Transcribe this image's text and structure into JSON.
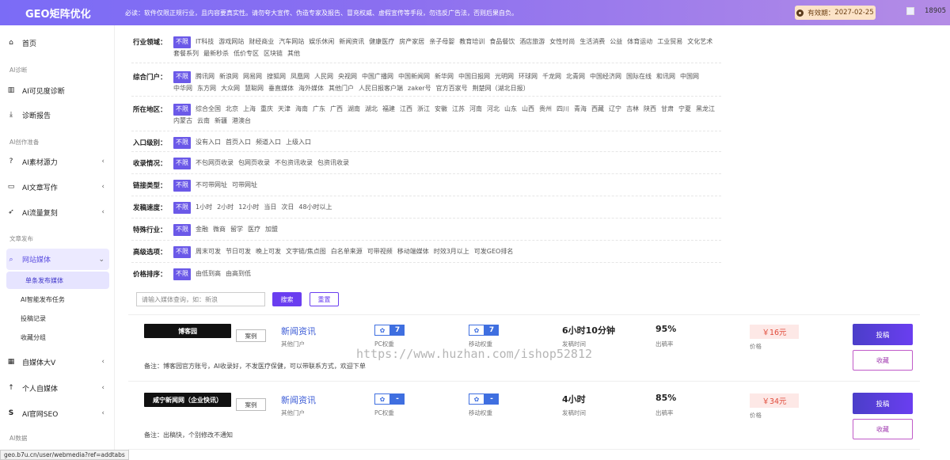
{
  "topbar": {
    "brand": "GEO矩阵优化",
    "notice": "必读：软件仅限正规行业，且内容要真实性。请勿夸大宣传、伪造专家及报告、冒充权威、虚假宣传等手段，勿违反广告法，否则后果自负。",
    "expire_label": "有效期：",
    "expire_date": "2027-02-25",
    "user_id": "18905"
  },
  "sidebar": {
    "home": "首页",
    "sec_ai_diag": "AI诊断",
    "ai_visible": "AI可见度诊断",
    "diag_report": "诊断报告",
    "sec_ai_create": "AI创作准备",
    "ai_source": "AI素材源力",
    "ai_article": "AI文章写作",
    "ai_traffic": "AI流量复刻",
    "sec_publish": "文章发布",
    "web_media": "网站媒体",
    "single_publish": "单条发布媒体",
    "ai_smart_task": "AI智能发布任务",
    "post_record": "投稿记录",
    "fav_group": "收藏分组",
    "self_media_v": "自媒体大V",
    "personal_media": "个人自媒体",
    "ai_official_seo": "AI官网SEO",
    "sec_ai_data": "AI数据"
  },
  "filters": [
    {
      "label": "行业领域：",
      "options": [
        "不限",
        "IT科技",
        "游戏网站",
        "财经商业",
        "汽车网站",
        "娱乐休闲",
        "新闻资讯",
        "健康医疗",
        "房产家居",
        "亲子母婴",
        "教育培训",
        "食品餐饮",
        "酒店旅游",
        "女性时尚",
        "生活消费",
        "公益",
        "体育运动",
        "工业贸易",
        "文化艺术",
        "套餐系列",
        "最新秒杀",
        "低价专区",
        "区块链",
        "其他"
      ]
    },
    {
      "label": "综合门户：",
      "options": [
        "不限",
        "腾讯网",
        "新浪网",
        "网易网",
        "搜狐网",
        "凤凰网",
        "人民网",
        "央视网",
        "中国广播网",
        "中国新闻网",
        "新华网",
        "中国日报网",
        "光明网",
        "环球网",
        "千龙网",
        "北青网",
        "中国经济网",
        "国际在线",
        "和讯网",
        "中国网",
        "中华网",
        "东方网",
        "大众网",
        "慧聪网",
        "垂直媒体",
        "海外媒体",
        "其他门户",
        "人民日报客户端",
        "zaker号",
        "官方百家号",
        "荆楚网（湖北日报）"
      ]
    },
    {
      "label": "所在地区：",
      "options": [
        "不限",
        "综合全国",
        "北京",
        "上海",
        "重庆",
        "天津",
        "海南",
        "广东",
        "广西",
        "湖南",
        "湖北",
        "福建",
        "江西",
        "浙江",
        "安徽",
        "江苏",
        "河南",
        "河北",
        "山东",
        "山西",
        "贵州",
        "四川",
        "青海",
        "西藏",
        "辽宁",
        "吉林",
        "陕西",
        "甘肃",
        "宁夏",
        "黑龙江",
        "内蒙古",
        "云南",
        "新疆",
        "港澳台"
      ]
    },
    {
      "label": "入口级别：",
      "options": [
        "不限",
        "没有入口",
        "首页入口",
        "频道入口",
        "上级入口"
      ]
    },
    {
      "label": "收录情况：",
      "options": [
        "不限",
        "不包网页收录",
        "包网页收录",
        "不包资讯收录",
        "包资讯收录"
      ]
    },
    {
      "label": "链接类型：",
      "options": [
        "不限",
        "不可带网址",
        "可带网址"
      ]
    },
    {
      "label": "发稿速度：",
      "options": [
        "不限",
        "1小时",
        "2小时",
        "12小时",
        "当日",
        "次日",
        "48小时以上"
      ]
    },
    {
      "label": "特殊行业：",
      "options": [
        "不限",
        "金融",
        "微商",
        "留学",
        "医疗",
        "加盟"
      ]
    },
    {
      "label": "高级选项：",
      "options": [
        "不限",
        "周末可发",
        "节日可发",
        "晚上可发",
        "文字链/焦点图",
        "白名单来源",
        "可带视频",
        "移动端媒体",
        "时效3月以上",
        "可发GEO排名"
      ]
    },
    {
      "label": "价格排序：",
      "options": [
        "不限",
        "由低到高",
        "由高到低"
      ]
    }
  ],
  "search": {
    "placeholder": "请输入媒体查询，如：新浪",
    "search_btn": "搜索",
    "reset_btn": "重置"
  },
  "cards": [
    {
      "name": "博客园",
      "case": "案例",
      "category": "新闻资讯",
      "category_sub": "其他门户",
      "pc_weight": "7",
      "pc_label": "PC权重",
      "mobile_weight": "7",
      "mobile_label": "移动权重",
      "time": "6小时10分钟",
      "time_label": "发稿时间",
      "rate": "95%",
      "rate_label": "出稿率",
      "price": "￥16元",
      "price_label": "价格",
      "post_btn": "投稿",
      "fav_btn": "收藏",
      "note": "备注：博客园官方账号，AI收录好，不发医疗保健，可以带联系方式，欢迎下单"
    },
    {
      "name": "咸宁新闻网（企业快讯）",
      "case": "案例",
      "category": "新闻资讯",
      "category_sub": "其他门户",
      "pc_weight": "-",
      "pc_label": "PC权重",
      "mobile_weight": "-",
      "mobile_label": "移动权重",
      "time": "4小时",
      "time_label": "发稿时间",
      "rate": "85%",
      "rate_label": "出稿率",
      "price": "￥34元",
      "price_label": "价格",
      "post_btn": "投稿",
      "fav_btn": "收藏",
      "note": "备注：出稿快，个别修改不通知"
    }
  ],
  "watermark": "https://www.huzhan.com/ishop52812",
  "status_url": "geo.b7u.cn/user/webmedia?ref=addtabs"
}
